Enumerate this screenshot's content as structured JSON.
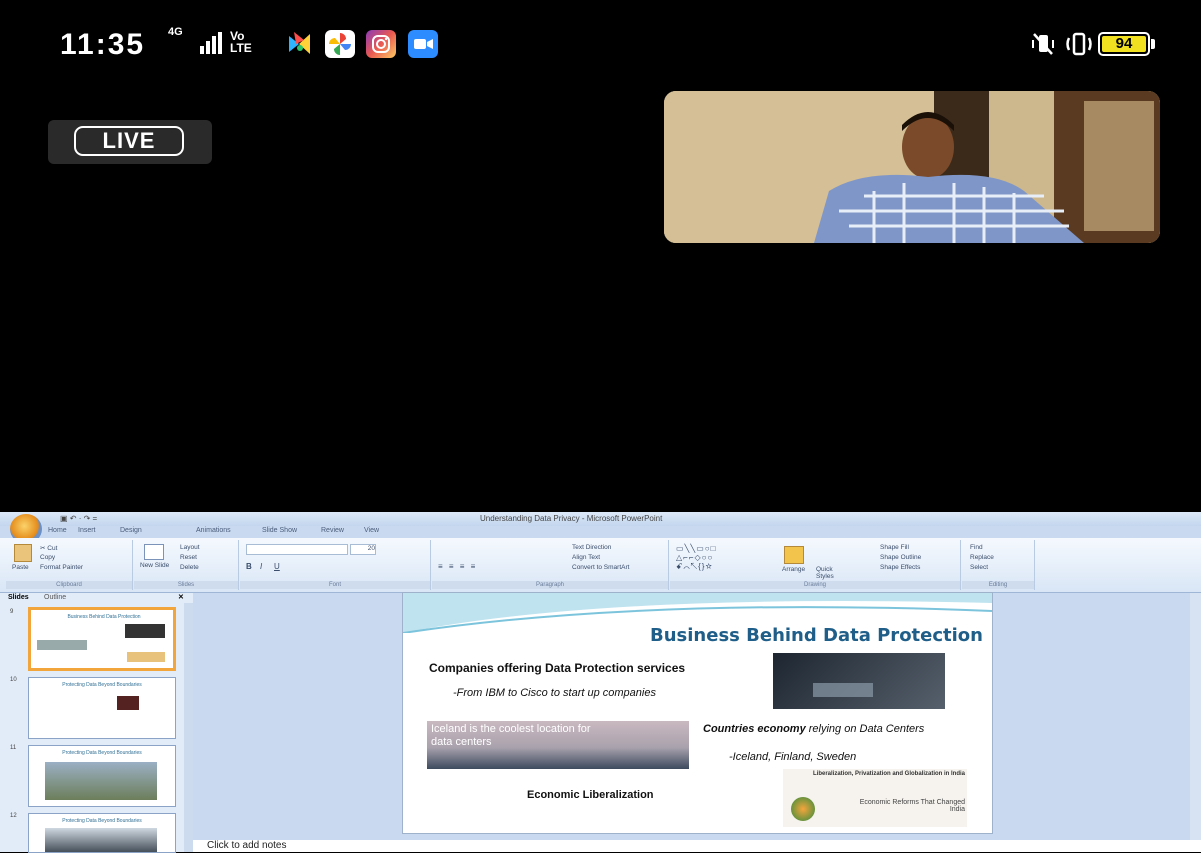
{
  "status_bar": {
    "time": "11:35",
    "network_label": "4G",
    "volte_label": "Vo\nLTE",
    "battery": "94",
    "app_icons": [
      "play-games-icon",
      "google-photos-icon",
      "instagram-icon",
      "zoom-icon"
    ],
    "right_icons": [
      "vibrate-mute-icon",
      "vibrate-icon"
    ]
  },
  "stream": {
    "live_label": "LIVE"
  },
  "powerpoint": {
    "window_title": "Understanding Data Privacy - Microsoft PowerPoint",
    "tabs": [
      "Home",
      "Insert",
      "Design",
      "Animations",
      "Slide Show",
      "Review",
      "View"
    ],
    "ribbon": {
      "clipboard": {
        "label": "Clipboard",
        "paste": "Paste",
        "cut": "Cut",
        "copy": "Copy",
        "format_painter": "Format Painter"
      },
      "slides": {
        "label": "Slides",
        "new_slide": "New Slide",
        "layout": "Layout",
        "reset": "Reset",
        "delete": "Delete"
      },
      "font": {
        "label": "Font",
        "size": "20"
      },
      "paragraph": {
        "label": "Paragraph",
        "text_direction": "Text Direction",
        "align_text": "Align Text",
        "convert": "Convert to SmartArt"
      },
      "drawing": {
        "label": "Drawing",
        "arrange": "Arrange",
        "quick_styles": "Quick Styles",
        "shape_fill": "Shape Fill",
        "shape_outline": "Shape Outline",
        "shape_effects": "Shape Effects"
      },
      "editing": {
        "label": "Editing",
        "find": "Find",
        "replace": "Replace",
        "select": "Select"
      }
    },
    "panel_tabs": [
      "Slides",
      "Outline"
    ],
    "thumbnails": [
      {
        "num": "9",
        "title": "Business Behind Data Protection"
      },
      {
        "num": "10",
        "title": "Protecting Data Beyond Boundaries"
      },
      {
        "num": "11",
        "title": "Protecting Data Beyond Boundaries"
      },
      {
        "num": "12",
        "title": "Protecting Data Beyond Boundaries"
      }
    ],
    "slide": {
      "title": "Business Behind Data Protection",
      "companies_heading": "Companies offering Data Protection services",
      "companies_sub": "-From IBM to Cisco to start up companies",
      "iceland_text": "Iceland is the coolest location for data centers",
      "countries_bold": "Countries economy",
      "countries_rest": " relying on Data Centers",
      "countries_sub": "-Iceland, Finland, Sweden",
      "liberalization": "Economic  Liberalization",
      "lpg_title": "Liberalization, Privatization and Globalization in India",
      "lpg_sub": "Economic Reforms That Changed India"
    },
    "notes_placeholder": "Click to add notes"
  }
}
